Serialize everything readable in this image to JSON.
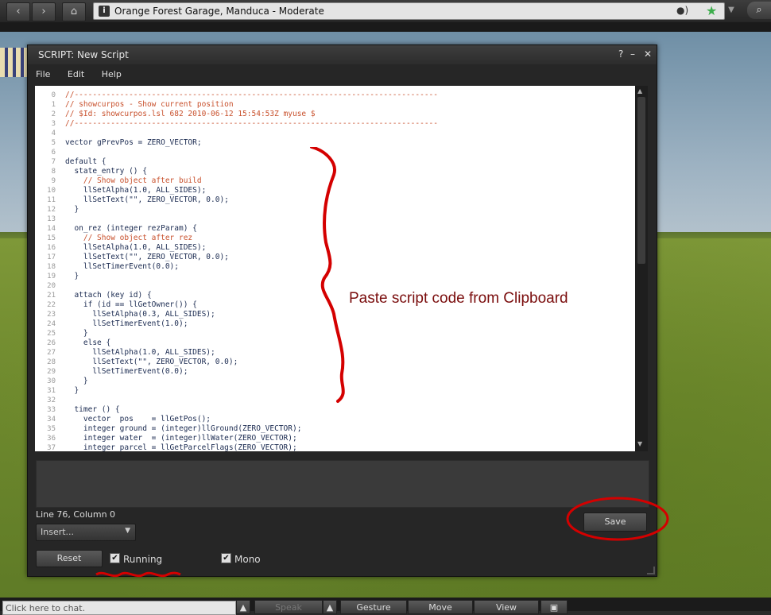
{
  "browser": {
    "back_icon": "chevron-left-icon",
    "forward_icon": "chevron-right-icon",
    "home_icon": "home-icon",
    "location": "Orange Forest Garage, Manduca - Moderate",
    "info_symbol": "i"
  },
  "floater": {
    "title": "SCRIPT: New Script",
    "help_symbol": "?",
    "minimize_symbol": "–",
    "close_symbol": "✕",
    "menu": [
      "File",
      "Edit",
      "Help"
    ],
    "line_numbers": [
      "0",
      "1",
      "2",
      "3",
      "4",
      "5",
      "6",
      "7",
      "8",
      "9",
      "10",
      "11",
      "12",
      "13",
      "14",
      "15",
      "16",
      "17",
      "18",
      "19",
      "20",
      "21",
      "22",
      "23",
      "24",
      "25",
      "26",
      "27",
      "28",
      "29",
      "30",
      "31",
      "32",
      "33",
      "34",
      "35",
      "36",
      "37"
    ],
    "code_lines": [
      "//--------------------------------------------------------------------------------",
      "// showcurpos - Show current position",
      "// $Id: showcurpos.lsl 682 2010-06-12 15:54:53Z myuse $",
      "//--------------------------------------------------------------------------------",
      "",
      "vector gPrevPos = ZERO_VECTOR;",
      "",
      "default {",
      "  state_entry () {",
      "    // Show object after build",
      "    llSetAlpha(1.0, ALL_SIDES);",
      "    llSetText(\"\", ZERO_VECTOR, 0.0);",
      "  }",
      "",
      "  on_rez (integer rezParam) {",
      "    // Show object after rez",
      "    llSetAlpha(1.0, ALL_SIDES);",
      "    llSetText(\"\", ZERO_VECTOR, 0.0);",
      "    llSetTimerEvent(0.0);",
      "  }",
      "",
      "  attach (key id) {",
      "    if (id == llGetOwner()) {",
      "      llSetAlpha(0.3, ALL_SIDES);",
      "      llSetTimerEvent(1.0);",
      "    }",
      "    else {",
      "      llSetAlpha(1.0, ALL_SIDES);",
      "      llSetText(\"\", ZERO_VECTOR, 0.0);",
      "      llSetTimerEvent(0.0);",
      "    }",
      "  }",
      "",
      "  timer () {",
      "    vector  pos    = llGetPos();",
      "    integer ground = (integer)llGround(ZERO_VECTOR);",
      "    integer water  = (integer)llWater(ZERO_VECTOR);",
      "    integer parcel = llGetParcelFlags(ZERO_VECTOR);"
    ],
    "annotation": "Paste script code from Clipboard",
    "status": "Line 76, Column 0",
    "insert_label": "Insert...",
    "save_label": "Save",
    "reset_label": "Reset",
    "running_label": "Running",
    "running_checked": true,
    "mono_label": "Mono",
    "mono_checked": true,
    "check_symbol": "✔"
  },
  "bottom_bar": {
    "chat_placeholder": "Click here to chat.",
    "speak_label": "Speak",
    "gesture_label": "Gesture",
    "move_label": "Move",
    "view_label": "View",
    "snapshot_icon": "camera-icon"
  },
  "colors": {
    "annotation": "#7a0d0d",
    "squiggle": "#d40000",
    "comment": "#c8502c",
    "favorite_star": "#3cae4c"
  }
}
